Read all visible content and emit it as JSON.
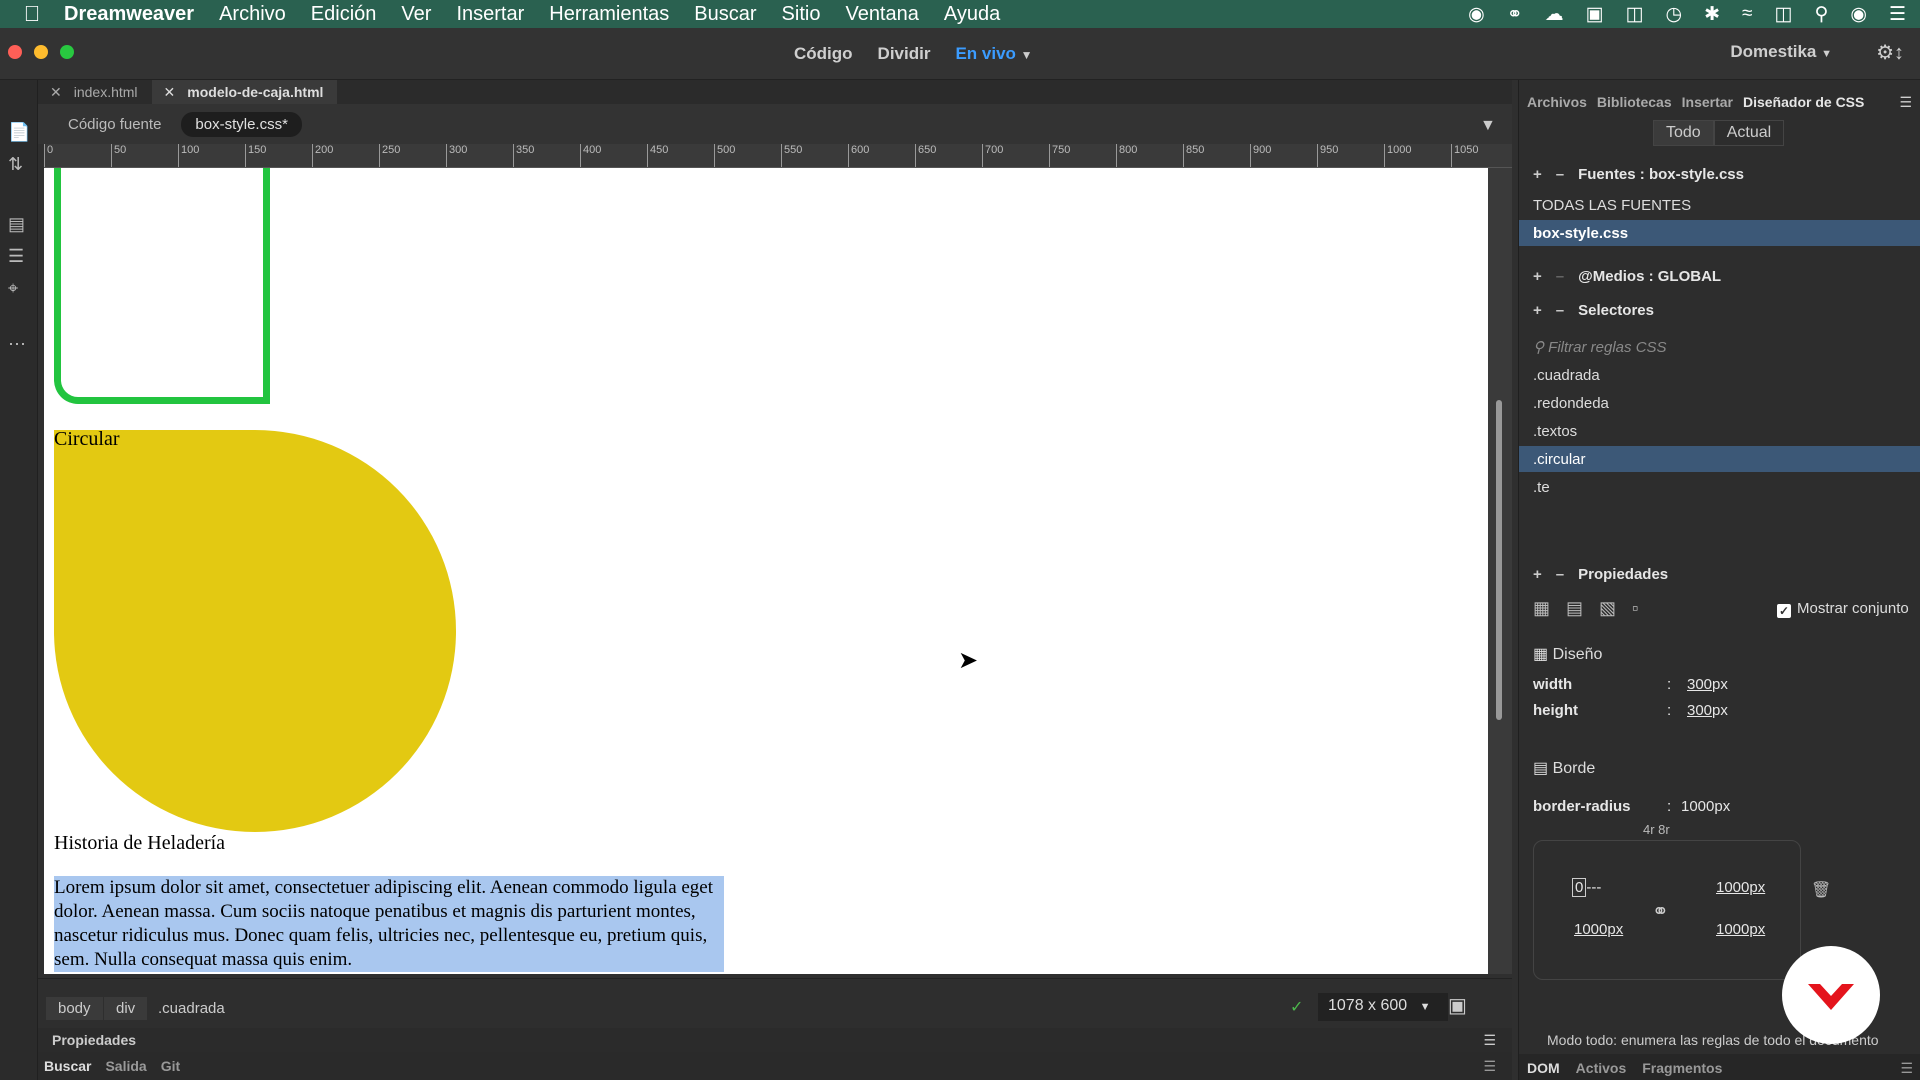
{
  "menubar": {
    "app": "Dreamweaver",
    "items": [
      "Archivo",
      "Edición",
      "Ver",
      "Insertar",
      "Herramientas",
      "Buscar",
      "Sitio",
      "Ventana",
      "Ayuda"
    ]
  },
  "viewmodes": {
    "code": "Código",
    "split": "Dividir",
    "live": "En vivo"
  },
  "site": "Domestika",
  "tabs": [
    {
      "label": "index.html"
    },
    {
      "label": "modelo-de-caja.html"
    }
  ],
  "related": {
    "source": "Código fuente",
    "file": "box-style.css*"
  },
  "ruler": [
    "0",
    "50",
    "100",
    "150",
    "200",
    "250",
    "300",
    "350",
    "400",
    "450",
    "500",
    "550",
    "600",
    "650",
    "700",
    "750",
    "800",
    "850",
    "900",
    "950",
    "1000",
    "1050"
  ],
  "content": {
    "circle_label": "Circular",
    "heading": "Historia de Heladería",
    "lorem": "Lorem ipsum dolor sit amet, consectetuer adipiscing elit. Aenean commodo ligula eget dolor. Aenean massa. Cum sociis natoque penatibus et magnis dis parturient montes, nascetur ridiculus mus. Donec quam felis, ultricies nec, pellentesque eu, pretium quis, sem. Nulla consequat massa quis enim."
  },
  "status": {
    "crumbs": [
      "body",
      "div",
      ".cuadrada"
    ],
    "size": "1078 x 600"
  },
  "bottom": {
    "props": "Propiedades",
    "tabs": [
      "Buscar",
      "Salida",
      "Git"
    ]
  },
  "panel": {
    "tabs": [
      "Archivos",
      "Bibliotecas",
      "Insertar",
      "Diseñador de CSS"
    ],
    "toggle": [
      "Todo",
      "Actual"
    ],
    "sources_title": "Fuentes : box-style.css",
    "sources": [
      "TODAS LAS FUENTES",
      "box-style.css"
    ],
    "media_title": "@Medios : GLOBAL",
    "selectors_title": "Selectores",
    "filter_placeholder": "Filtrar reglas CSS",
    "selectors": [
      ".cuadrada",
      ".redondeda",
      ".textos",
      ".circular",
      ".te"
    ],
    "properties_title": "Propiedades",
    "show_set": "Mostrar conjunto",
    "layout_cat": "Diseño",
    "width_label": "width",
    "width_val": "300",
    "width_unit": "px",
    "height_label": "height",
    "height_val": "300",
    "height_unit": "px",
    "border_cat": "Borde",
    "radius_label": "border-radius",
    "radius_val": "1000px",
    "radius_hint": "4r  8r",
    "radius_tl": "0",
    "radius_tl_suffix": "---",
    "radius_tr": "1000px",
    "radius_bl": "1000px",
    "radius_br": "1000px",
    "mode_note": "Modo todo: enumera las reglas de todo el documento",
    "bottom_tabs": [
      "DOM",
      "Activos",
      "Fragmentos"
    ]
  }
}
